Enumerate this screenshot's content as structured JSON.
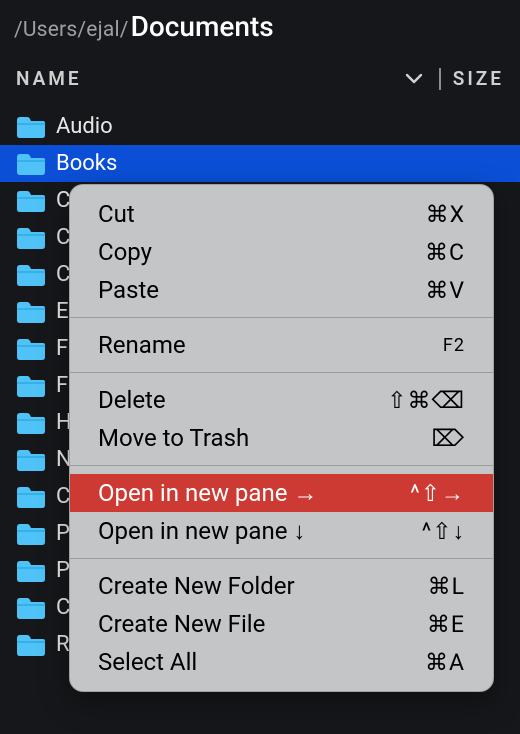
{
  "path": {
    "prefix": "/Users/ejal/",
    "current": "Documents"
  },
  "columns": {
    "name": "NAME",
    "size": "SIZE"
  },
  "rows": [
    {
      "label": "Audio",
      "selected": false
    },
    {
      "label": "Books",
      "selected": true
    },
    {
      "label": "C",
      "selected": false
    },
    {
      "label": "C",
      "selected": false
    },
    {
      "label": "C",
      "selected": false
    },
    {
      "label": "E",
      "selected": false
    },
    {
      "label": "F",
      "selected": false
    },
    {
      "label": "F",
      "selected": false
    },
    {
      "label": "H",
      "selected": false
    },
    {
      "label": "N",
      "selected": false
    },
    {
      "label": "C",
      "selected": false
    },
    {
      "label": "P",
      "selected": false
    },
    {
      "label": "P",
      "selected": false
    },
    {
      "label": "C",
      "selected": false
    },
    {
      "label": "Reference Cases",
      "selected": false
    }
  ],
  "menu": {
    "groups": [
      [
        {
          "id": "cut",
          "label": "Cut",
          "shortcut": "⌘X"
        },
        {
          "id": "copy",
          "label": "Copy",
          "shortcut": "⌘C"
        },
        {
          "id": "paste",
          "label": "Paste",
          "shortcut": "⌘V"
        }
      ],
      [
        {
          "id": "rename",
          "label": "Rename",
          "shortcut": "F2",
          "shortcut_small": true
        }
      ],
      [
        {
          "id": "delete",
          "label": "Delete",
          "shortcut": "⇧⌘⌫"
        },
        {
          "id": "trash",
          "label": "Move to Trash",
          "shortcut": "⌦"
        }
      ],
      [
        {
          "id": "open-right",
          "label": "Open in new pane →",
          "shortcut": "^⇧→",
          "highlight": true
        },
        {
          "id": "open-down",
          "label": "Open in new pane ↓",
          "shortcut": "^⇧↓"
        }
      ],
      [
        {
          "id": "new-folder",
          "label": "Create New Folder",
          "shortcut": "⌘L"
        },
        {
          "id": "new-file",
          "label": "Create New File",
          "shortcut": "⌘E"
        },
        {
          "id": "select-all",
          "label": "Select All",
          "shortcut": "⌘A"
        }
      ]
    ]
  }
}
